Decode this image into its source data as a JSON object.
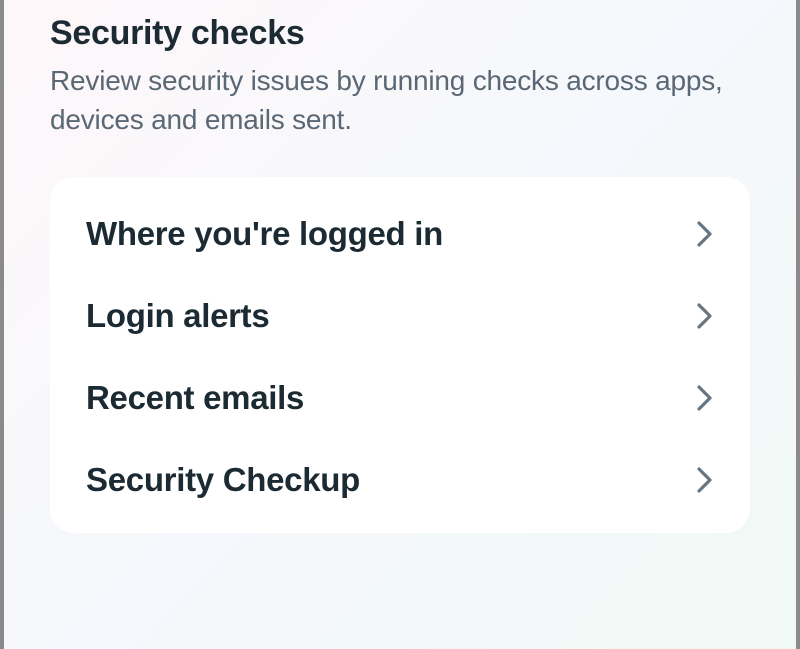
{
  "header": {
    "title": "Security checks",
    "subtitle": "Review security issues by running checks across apps, devices and emails sent."
  },
  "items": [
    {
      "label": "Where you're logged in"
    },
    {
      "label": "Login alerts"
    },
    {
      "label": "Recent emails"
    },
    {
      "label": "Security Checkup"
    }
  ]
}
